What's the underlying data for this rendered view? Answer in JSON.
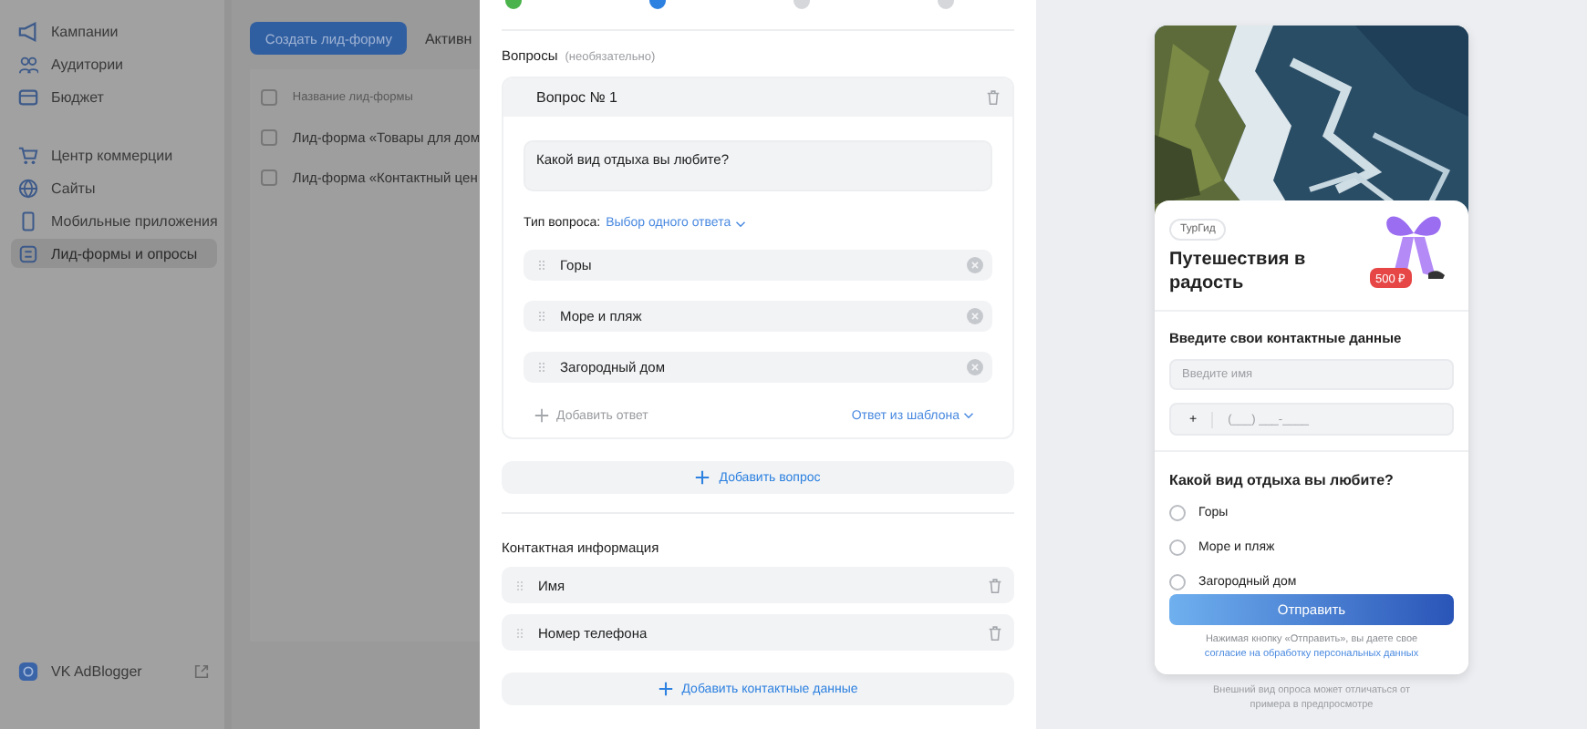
{
  "sidebar": {
    "sections": [
      {
        "items": [
          {
            "label": "Кампании",
            "kind": "megaphone",
            "selected": false
          },
          {
            "label": "Аудитории",
            "kind": "people",
            "selected": false
          },
          {
            "label": "Бюджет",
            "kind": "wallet",
            "selected": false
          }
        ]
      },
      {
        "items": [
          {
            "label": "Центр коммерции",
            "kind": "cart",
            "selected": false
          },
          {
            "label": "Сайты",
            "kind": "globe",
            "selected": false
          },
          {
            "label": "Мобильные приложения",
            "kind": "phone",
            "selected": false
          },
          {
            "label": "Лид-формы и опросы",
            "kind": "form",
            "selected": true
          }
        ]
      }
    ],
    "footer": {
      "label": "VK AdBlogger"
    }
  },
  "list": {
    "create_button": "Создать лид-форму",
    "tab": "Активн",
    "header": "Название лид-формы",
    "all_checked": false,
    "rows": [
      {
        "title": "Лид-форма «Товары для дом",
        "checked": false
      },
      {
        "title": "Лид-форма «Контактный цен",
        "checked": false
      }
    ]
  },
  "steps": [
    {
      "done": true,
      "selected": false
    },
    {
      "done": false,
      "selected": true
    },
    {
      "done": false,
      "selected": false
    },
    {
      "done": false,
      "selected": false
    }
  ],
  "questions": {
    "title": "Вопросы",
    "hint": "(необязательно)",
    "items": [
      {
        "title": "Вопрос № 1",
        "text": "Какой вид отдыха вы любите?",
        "type_label": "Тип вопроса:",
        "type_value": "Выбор одного ответа",
        "answers": [
          "Горы",
          "Море и пляж",
          "Загородный дом"
        ],
        "add_answer": "Добавить ответ",
        "from_template": "Ответ из шаблона"
      }
    ],
    "add_question": "Добавить вопрос"
  },
  "contacts": {
    "title": "Контактная информация",
    "fields": [
      "Имя",
      "Номер телефона"
    ],
    "add": "Добавить контактные данные"
  },
  "preview": {
    "brand": "ТурГид",
    "headline": "Путешествия в радость",
    "price": "500 ₽",
    "contacts_title": "Введите свои контактные данные",
    "name_placeholder": "Введите имя",
    "phone_prefix": "+",
    "phone_placeholder": "(___) ___-____",
    "question": "Какой вид отдыха вы любите?",
    "options": [
      {
        "label": "Горы",
        "selected": false
      },
      {
        "label": "Море и пляж",
        "selected": false
      },
      {
        "label": "Загородный дом",
        "selected": false
      }
    ],
    "submit": "Отправить",
    "consent_text": "Нажимая кнопку «Отправить», вы даете свое",
    "consent_link": "согласие на обработку персональных данных",
    "note": "Внешний вид опроса может отличаться от примера в предпросмотре"
  }
}
